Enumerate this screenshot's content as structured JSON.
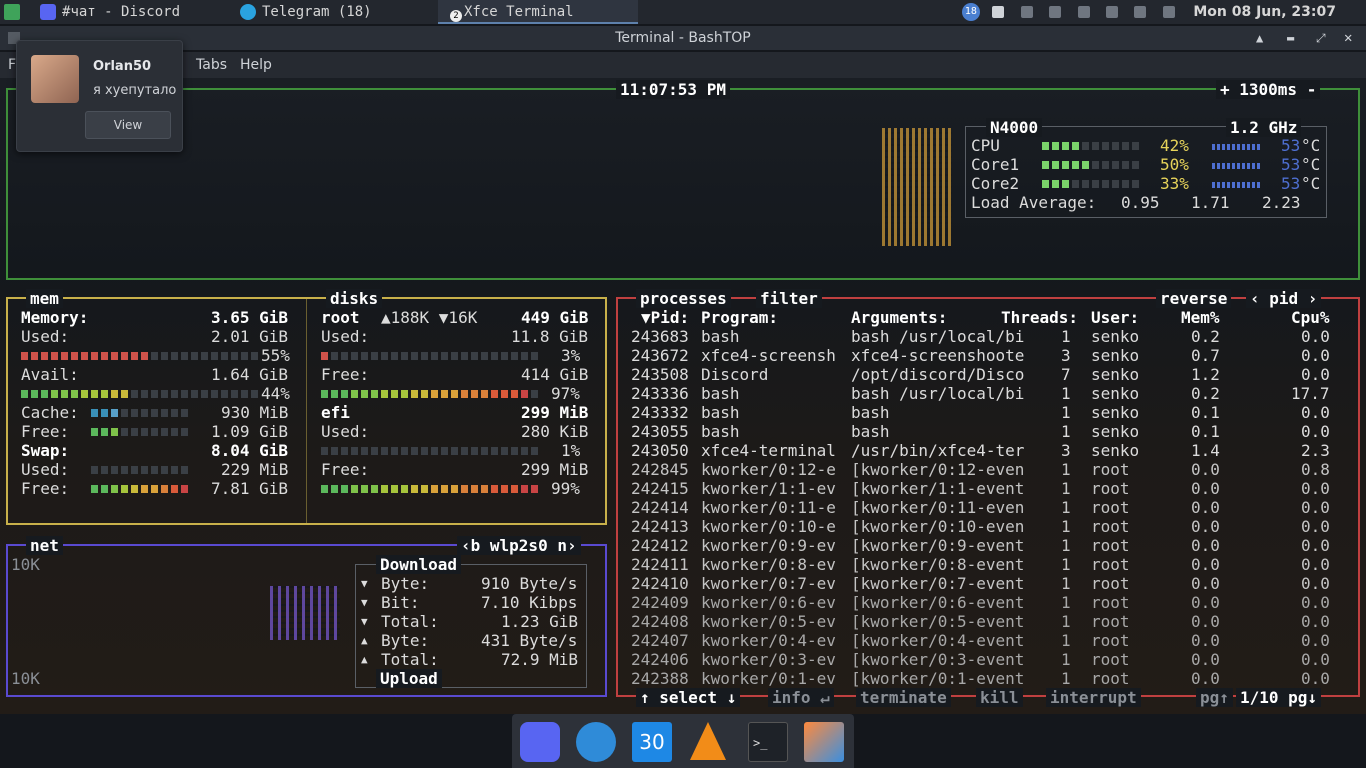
{
  "taskbar": {
    "tasks": [
      {
        "label": "чат - Discord",
        "icon": "discord-icon"
      },
      {
        "label": "Telegram (18)",
        "icon": "telegram-icon"
      },
      {
        "label": "Xfce Terminal",
        "icon": "terminal-icon",
        "badge": "2"
      }
    ],
    "tray_badge": "18",
    "clock": "Mon 08 Jun, 23:07"
  },
  "window": {
    "title": "Terminal - BashTOP",
    "menu": [
      "Fi",
      "Tabs",
      "Help"
    ]
  },
  "notification": {
    "sender": "Orlan50",
    "message": "я хуепутало",
    "view_label": "View"
  },
  "cpu": {
    "clock_time": "11:07:53 PM",
    "interval": "+ 1300ms -",
    "model": "N4000",
    "freq": "1.2 GHz",
    "rows": [
      {
        "name": "CPU",
        "pct": "42%",
        "temp": "53",
        "unit": "°C",
        "fill": 0.42
      },
      {
        "name": "Core1",
        "pct": "50%",
        "temp": "53",
        "unit": "°C",
        "fill": 0.5
      },
      {
        "name": "Core2",
        "pct": "33%",
        "temp": "53",
        "unit": "°C",
        "fill": 0.33
      }
    ],
    "load_label": "Load Average:",
    "load": [
      "0.95",
      "1.71",
      "2.23"
    ]
  },
  "mem": {
    "title": "mem",
    "memory_label": "Memory:",
    "memory_val": "3.65 GiB",
    "used_label": "Used:",
    "used_val": "2.01 GiB",
    "used_pct": "55%",
    "used_fill": 0.55,
    "avail_label": "Avail:",
    "avail_val": "1.64 GiB",
    "avail_pct": "44%",
    "avail_fill": 0.44,
    "cache_label": "Cache:",
    "cache_val": "930 MiB",
    "cache_fill": 0.25,
    "free_label": "Free:",
    "free_val": "1.09 GiB",
    "free_fill": 0.3,
    "swap_label": "Swap:",
    "swap_val": "8.04 GiB",
    "swap_used_label": "Used:",
    "swap_used_val": "229 MiB",
    "swap_used_fill": 0.03,
    "swap_free_label": "Free:",
    "swap_free_val": "7.81 GiB",
    "swap_free_fill": 0.97
  },
  "disks": {
    "title": "disks",
    "root_name": "root",
    "root_io": "▲188K ▼16K",
    "root_total": "449 GiB",
    "root_used_label": "Used:",
    "root_used_val": "11.8 GiB",
    "root_used_pct": "3%",
    "root_used_fill": 0.03,
    "root_free_label": "Free:",
    "root_free_val": "414 GiB",
    "root_free_pct": "97%",
    "root_free_fill": 0.97,
    "efi_name": "efi",
    "efi_total": "299 MiB",
    "efi_used_label": "Used:",
    "efi_used_val": "280 KiB",
    "efi_used_pct": "1%",
    "efi_used_fill": 0.01,
    "efi_free_label": "Free:",
    "efi_free_val": "299 MiB",
    "efi_free_pct": "99%",
    "efi_free_fill": 0.99
  },
  "net": {
    "title": "net",
    "iface": "‹b wlp2s0 n›",
    "scale_top": "10K",
    "scale_bottom": "10K",
    "download_label": "Download",
    "upload_label": "Upload",
    "rows": [
      {
        "arrow": "▼",
        "label": "Byte:",
        "value": "910 Byte/s"
      },
      {
        "arrow": "▼",
        "label": "Bit:",
        "value": "7.10 Kibps"
      },
      {
        "arrow": "▼",
        "label": "Total:",
        "value": "1.23 GiB"
      },
      {
        "arrow": "▲",
        "label": "Byte:",
        "value": "431 Byte/s"
      },
      {
        "arrow": "▲",
        "label": "Total:",
        "value": "72.9 MiB"
      }
    ]
  },
  "proc": {
    "title": "processes",
    "filter": "filter",
    "reverse": "reverse",
    "sort": "‹ pid ›",
    "headers": {
      "pid": "▼Pid:",
      "program": "Program:",
      "args": "Arguments:",
      "threads": "Threads:",
      "user": "User:",
      "mem": "Mem%",
      "cpu": "Cpu%"
    },
    "rows": [
      {
        "pid": "243683",
        "program": "bash",
        "args": "bash /usr/local/bi",
        "threads": "1",
        "user": "senko",
        "mem": "0.2",
        "cpu": "0.0"
      },
      {
        "pid": "243672",
        "program": "xfce4-screensh",
        "args": "xfce4-screenshoote",
        "threads": "3",
        "user": "senko",
        "mem": "0.7",
        "cpu": "0.0"
      },
      {
        "pid": "243508",
        "program": "Discord",
        "args": "/opt/discord/Disco",
        "threads": "7",
        "user": "senko",
        "mem": "1.2",
        "cpu": "0.0"
      },
      {
        "pid": "243336",
        "program": "bash",
        "args": "bash /usr/local/bi",
        "threads": "1",
        "user": "senko",
        "mem": "0.2",
        "cpu": "17.7"
      },
      {
        "pid": "243332",
        "program": "bash",
        "args": "bash",
        "threads": "1",
        "user": "senko",
        "mem": "0.1",
        "cpu": "0.0"
      },
      {
        "pid": "243055",
        "program": "bash",
        "args": "bash",
        "threads": "1",
        "user": "senko",
        "mem": "0.1",
        "cpu": "0.0"
      },
      {
        "pid": "243050",
        "program": "xfce4-terminal",
        "args": "/usr/bin/xfce4-ter",
        "threads": "3",
        "user": "senko",
        "mem": "1.4",
        "cpu": "2.3"
      },
      {
        "pid": "242845",
        "program": "kworker/0:12-e",
        "args": "[kworker/0:12-even",
        "threads": "1",
        "user": "root",
        "mem": "0.0",
        "cpu": "0.8"
      },
      {
        "pid": "242415",
        "program": "kworker/1:1-ev",
        "args": "[kworker/1:1-event",
        "threads": "1",
        "user": "root",
        "mem": "0.0",
        "cpu": "0.0"
      },
      {
        "pid": "242414",
        "program": "kworker/0:11-e",
        "args": "[kworker/0:11-even",
        "threads": "1",
        "user": "root",
        "mem": "0.0",
        "cpu": "0.0"
      },
      {
        "pid": "242413",
        "program": "kworker/0:10-e",
        "args": "[kworker/0:10-even",
        "threads": "1",
        "user": "root",
        "mem": "0.0",
        "cpu": "0.0"
      },
      {
        "pid": "242412",
        "program": "kworker/0:9-ev",
        "args": "[kworker/0:9-event",
        "threads": "1",
        "user": "root",
        "mem": "0.0",
        "cpu": "0.0"
      },
      {
        "pid": "242411",
        "program": "kworker/0:8-ev",
        "args": "[kworker/0:8-event",
        "threads": "1",
        "user": "root",
        "mem": "0.0",
        "cpu": "0.0"
      },
      {
        "pid": "242410",
        "program": "kworker/0:7-ev",
        "args": "[kworker/0:7-event",
        "threads": "1",
        "user": "root",
        "mem": "0.0",
        "cpu": "0.0"
      },
      {
        "pid": "242409",
        "program": "kworker/0:6-ev",
        "args": "[kworker/0:6-event",
        "threads": "1",
        "user": "root",
        "mem": "0.0",
        "cpu": "0.0"
      },
      {
        "pid": "242408",
        "program": "kworker/0:5-ev",
        "args": "[kworker/0:5-event",
        "threads": "1",
        "user": "root",
        "mem": "0.0",
        "cpu": "0.0"
      },
      {
        "pid": "242407",
        "program": "kworker/0:4-ev",
        "args": "[kworker/0:4-event",
        "threads": "1",
        "user": "root",
        "mem": "0.0",
        "cpu": "0.0"
      },
      {
        "pid": "242406",
        "program": "kworker/0:3-ev",
        "args": "[kworker/0:3-event",
        "threads": "1",
        "user": "root",
        "mem": "0.0",
        "cpu": "0.0"
      },
      {
        "pid": "242388",
        "program": "kworker/0:1-ev",
        "args": "[kworker/0:1-event",
        "threads": "1",
        "user": "root",
        "mem": "0.0",
        "cpu": "0.0"
      }
    ],
    "footer": {
      "select": "↑ select ↓",
      "info": "info ↵",
      "terminate": "terminate",
      "kill": "kill",
      "interrupt": "interrupt",
      "pg": "pg↑",
      "page": "1/10 pg↓"
    }
  },
  "dock": {
    "items": [
      {
        "name": "discord-dock-icon",
        "label": ""
      },
      {
        "name": "browser-dock-icon",
        "label": ""
      },
      {
        "name": "calendar-dock-icon",
        "label": "30"
      },
      {
        "name": "vlc-dock-icon",
        "label": ""
      },
      {
        "name": "terminal-dock-icon",
        "label": ">_"
      },
      {
        "name": "image-viewer-dock-icon",
        "label": ""
      }
    ]
  },
  "colors": {
    "cpu_border": "#3f8f3a",
    "mem_border": "#c8b04a",
    "net_border": "#5a4ad0",
    "proc_border": "#c04040",
    "accent_white": "#ffffff"
  }
}
